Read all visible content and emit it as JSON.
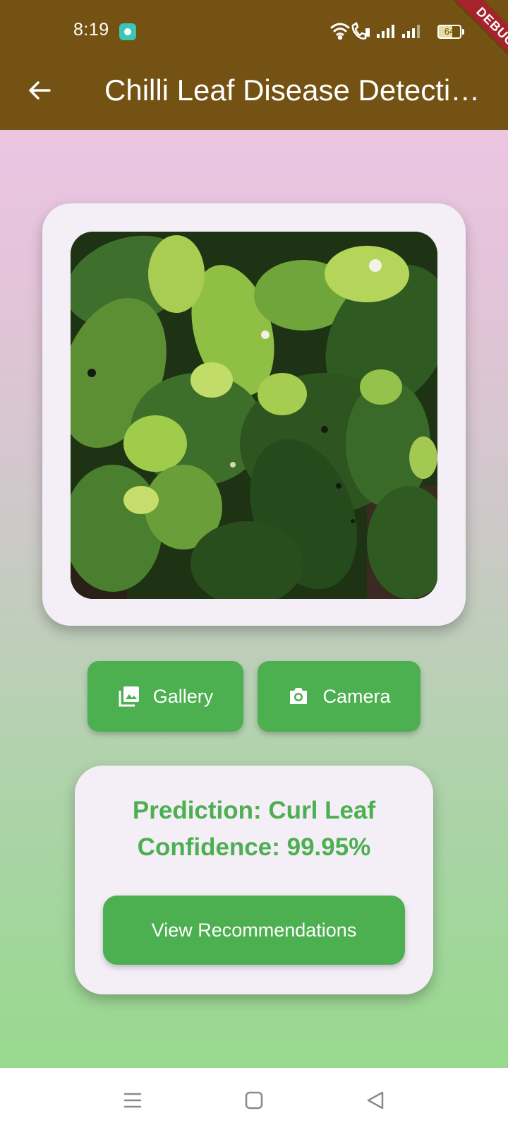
{
  "status_bar": {
    "time": "8:19",
    "battery_level": "64",
    "icons": [
      "app-notification-icon",
      "wifi-icon",
      "wifi-calling-icon",
      "signal-icon",
      "signal-icon",
      "battery-icon"
    ]
  },
  "app_bar": {
    "title": "Chilli Leaf Disease Detecti…",
    "back_icon": "arrow-back-icon"
  },
  "debug_banner": "DEBUG",
  "photo": {
    "description_icon": "leaf-photo"
  },
  "actions": {
    "gallery_label": "Gallery",
    "gallery_icon": "photo-library-icon",
    "camera_label": "Camera",
    "camera_icon": "camera-icon"
  },
  "result": {
    "prediction": "Prediction: Curl Leaf",
    "confidence": "Confidence: 99.95%",
    "recommend_label": "View Recommendations"
  },
  "nav_bar": {
    "icons": [
      "menu-icon",
      "home-icon",
      "back-icon"
    ]
  },
  "colors": {
    "app_bar": "#735213",
    "accent_green": "#4caf50",
    "card": "#f4eff7",
    "gradient_top": "#ecc5e3",
    "gradient_bottom": "#99d98f",
    "debug": "#a5232a"
  }
}
